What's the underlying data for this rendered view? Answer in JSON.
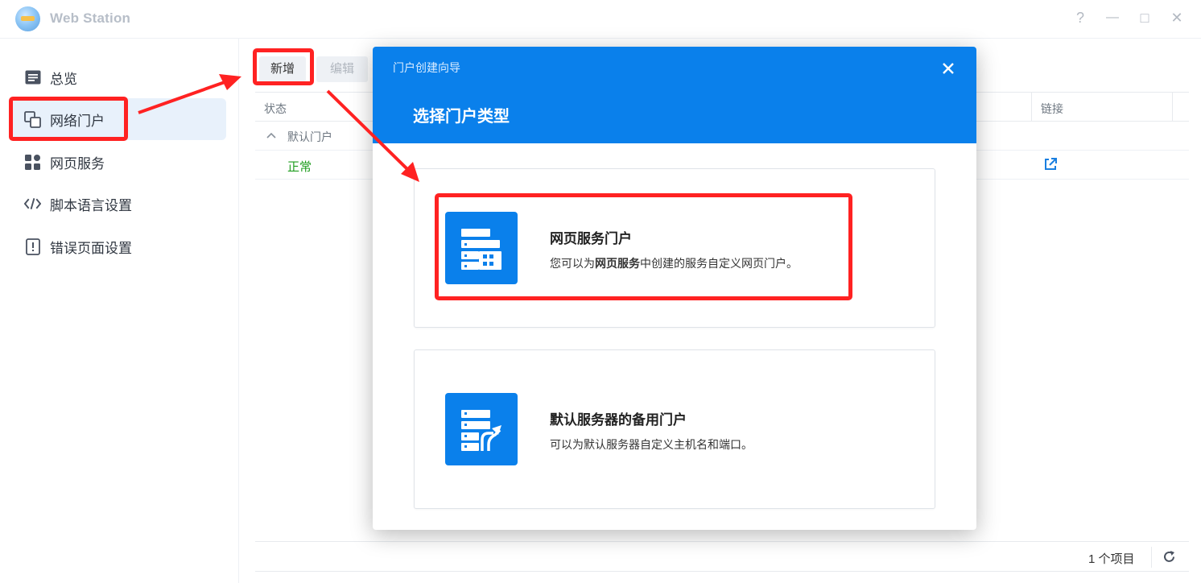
{
  "app": {
    "title": "Web Station"
  },
  "window_controls": {
    "help": "?",
    "minimize": "—",
    "maximize": "□",
    "close": "✕"
  },
  "sidebar": {
    "items": [
      {
        "label": "总览",
        "icon": "overview-icon",
        "active": false
      },
      {
        "label": "网络门户",
        "icon": "portal-icon",
        "active": true
      },
      {
        "label": "网页服务",
        "icon": "web-service-icon",
        "active": false
      },
      {
        "label": "脚本语言设置",
        "icon": "code-icon",
        "active": false
      },
      {
        "label": "错误页面设置",
        "icon": "error-page-icon",
        "active": false
      }
    ]
  },
  "toolbar": {
    "add_label": "新增",
    "edit_label": "编辑"
  },
  "table": {
    "columns": {
      "status": "状态",
      "link": "链接"
    },
    "group_label": "默认门户",
    "rows": [
      {
        "status": "正常",
        "link_icon": "external-link-icon"
      }
    ]
  },
  "footer": {
    "count_text": "1 个项目",
    "refresh_icon": "refresh-icon"
  },
  "dialog": {
    "header": "门户创建向导",
    "title": "选择门户类型",
    "options": [
      {
        "title": "网页服务门户",
        "desc_prefix": "您可以为",
        "desc_bold": "网页服务",
        "desc_suffix": "中创建的服务自定义网页门户。",
        "icon": "web-service-portal-icon"
      },
      {
        "title": "默认服务器的备用门户",
        "desc": "可以为默认服务器自定义主机名和端口。",
        "icon": "alias-portal-icon"
      }
    ]
  },
  "colors": {
    "accent": "#0a80eb",
    "status_ok": "#1f9d1f",
    "annotation": "#ff2222",
    "sidebar_active_bg": "#e8f1fb"
  }
}
